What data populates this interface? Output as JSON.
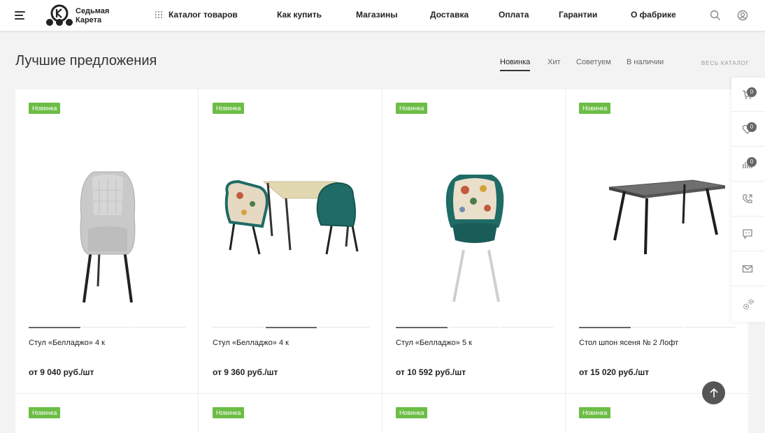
{
  "header": {
    "logo_text_line1": "Седьмая",
    "logo_text_line2": "Карета",
    "catalog_label": "Каталог товаров",
    "nav": [
      "Как купить",
      "Магазины",
      "Доставка",
      "Оплата",
      "Гарантии",
      "О фабрике"
    ]
  },
  "section": {
    "title": "Лучшие предложения",
    "tabs": [
      "Новинка",
      "Хит",
      "Советуем",
      "В наличии"
    ],
    "active_tab": "Новинка",
    "all_catalog": "ВЕСЬ КАТАЛОГ"
  },
  "products": [
    {
      "badge": "Новинка",
      "name": "Стул «Белладжо» 4 к",
      "price": "от 9 040 руб./шт",
      "image": "grey-chair",
      "slide": 1
    },
    {
      "badge": "Новинка",
      "name": "Стул «Белладжо» 4 к",
      "price": "от 9 360 руб./шт",
      "image": "table-set",
      "slide": 2
    },
    {
      "badge": "Новинка",
      "name": "Стул «Белладжо» 5 к",
      "price": "от 10 592 руб./шт",
      "image": "floral-chair",
      "slide": 1
    },
    {
      "badge": "Новинка",
      "name": "Стол шпон ясеня № 2 Лофт",
      "price": "от 15 020 руб./шт",
      "image": "loft-table",
      "slide": 1
    }
  ],
  "row2_badges": [
    "Новинка",
    "Новинка",
    "Новинка",
    "Новинка"
  ],
  "sidebar": {
    "cart_count": "0",
    "favorites_count": "0",
    "compare_count": "0",
    "buttons": [
      "cart-icon",
      "heart-icon",
      "compare-icon",
      "callback-icon",
      "chat-icon",
      "mail-icon",
      "settings-icon"
    ]
  },
  "colors": {
    "badge_green": "#6cbd45",
    "dark": "#333333",
    "teal": "#1f6b66"
  }
}
